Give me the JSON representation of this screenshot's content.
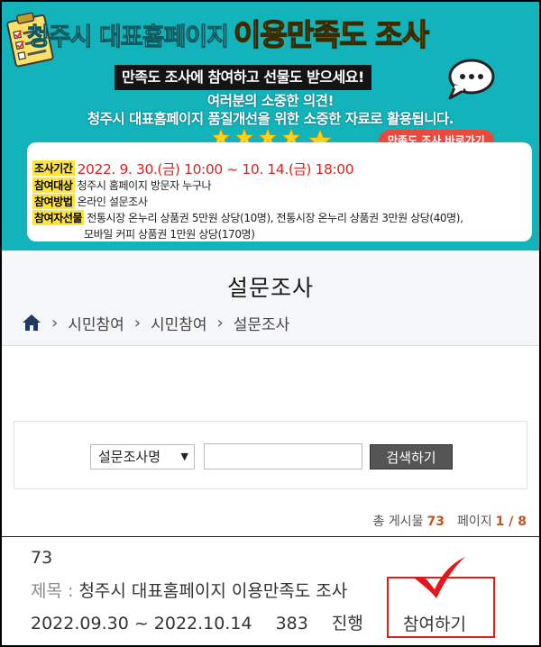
{
  "banner": {
    "title_white": "청주시 대표홈페이지",
    "title_yellow": "이용만족도 조사",
    "subtitle": "만족도 조사에 참여하고 선물도 받으세요!",
    "line1": "여러분의 소중한 의견!",
    "line2": "청주시 대표홈페이지 품질개선을 위한 소중한 자료로 활용됩니다.",
    "go_button": "만족도 조사 바로가기",
    "period_label": "조사기간",
    "period_value": "2022. 9. 30.(금) 10:00 ~ 10. 14.(금) 18:00",
    "target_label": "참여대상",
    "target_value": "청주시 홈페이지 방문자 누구나",
    "method_label": "참여방법",
    "method_value": "온라인 설문조사",
    "gift_label": "참여자선물",
    "gift_value_1": "전통시장 온누리 상품권 5만원 상당(10명), 전통시장 온누리 상품권 3만원 상당(40명),",
    "gift_value_2": "모바일 커피 상품권 1만원 상당(170명)",
    "star_color": "#ffd21a",
    "accent_color": "#12b3ba"
  },
  "page": {
    "title": "설문조사",
    "breadcrumb": [
      "시민참여",
      "시민참여",
      "설문조사"
    ]
  },
  "search": {
    "select_value": "설문조사명",
    "input_value": "",
    "button_label": "검색하기"
  },
  "meta": {
    "total_label": "총 게시물",
    "total_value": "73",
    "page_label": "페이지",
    "page_value": "1 / 8"
  },
  "item": {
    "number": "73",
    "title_label": "제목 :",
    "title": "청주시 대표홈페이지 이용만족도 조사",
    "period": "2022.09.30 ~ 2022.10.14",
    "count": "383",
    "status": "진행",
    "join_label": "참여하기"
  }
}
